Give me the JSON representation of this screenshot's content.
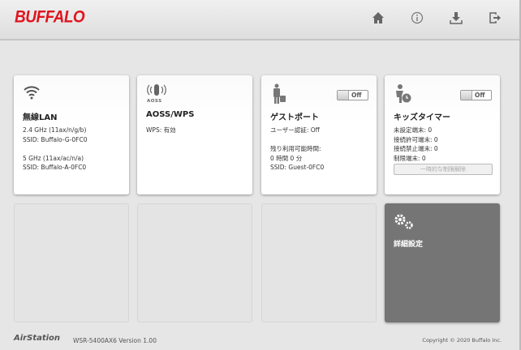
{
  "header": {
    "logo": "BUFFALO",
    "icons": [
      "home-icon",
      "info-icon",
      "download-icon",
      "logout-icon"
    ]
  },
  "cards": {
    "wireless": {
      "title": "無線LAN",
      "text": "2.4 GHz (11ax/n/g/b)\nSSID: Buffalo-G-0FC0\n\n5 GHz (11ax/ac/n/a)\nSSID: Buffalo-A-0FC0"
    },
    "aoss": {
      "title": "AOSS/WPS",
      "icon_label": "AOSS",
      "text": "WPS: 有効"
    },
    "guest": {
      "title": "ゲストポート",
      "toggle": "Off",
      "text": "ユーザー認証: Off\n\n残り利用可能時間:\n0 時間 0 分\nSSID: Guest-0FC0"
    },
    "kids": {
      "title": "キッズタイマー",
      "toggle": "Off",
      "text": "未設定端末: 0\n接続許可端末: 0\n接続禁止端末: 0\n制限端末: 0",
      "button": "一時的な制限解除"
    },
    "advanced": {
      "title": "詳細設定"
    }
  },
  "footer": {
    "brand": "AirStation",
    "version": "WSR-5400AX6 Version 1.00",
    "copyright": "Copyright © 2020 Buffalo Inc."
  }
}
